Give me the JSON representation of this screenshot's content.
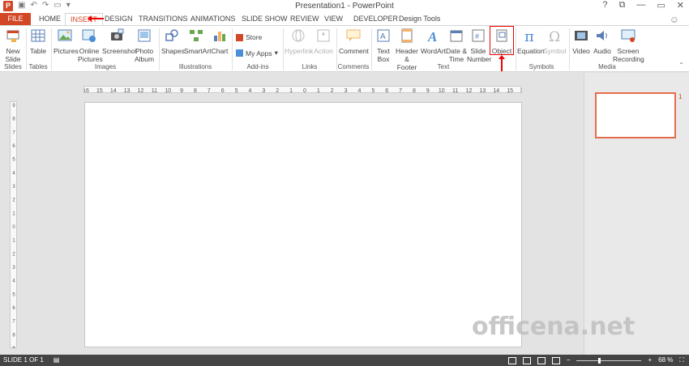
{
  "window": {
    "title": "Presentation1 - PowerPoint",
    "app_icon": "P",
    "controls": [
      "?",
      "⧉",
      "—",
      "▭",
      "✕"
    ]
  },
  "tabs": {
    "file": "FILE",
    "items": [
      "HOME",
      "INSERT",
      "DESIGN",
      "TRANSITIONS",
      "ANIMATIONS",
      "SLIDE SHOW",
      "REVIEW",
      "VIEW",
      "DEVELOPER",
      "Design Tools"
    ],
    "active": "INSERT"
  },
  "ribbon": {
    "slides": {
      "new_slide": "New Slide",
      "label": "Slides"
    },
    "tables": {
      "table": "Table",
      "label": "Tables"
    },
    "images": {
      "pictures": "Pictures",
      "online_pictures": "Online Pictures",
      "screenshot": "Screenshot",
      "photo_album": "Photo Album",
      "label": "Images"
    },
    "illustrations": {
      "shapes": "Shapes",
      "smartart": "SmartArt",
      "chart": "Chart",
      "label": "Illustrations"
    },
    "addins": {
      "store": "Store",
      "my_apps": "My Apps",
      "label": "Add-ins"
    },
    "links": {
      "hyperlink": "Hyperlink",
      "action": "Action",
      "label": "Links"
    },
    "comments": {
      "comment": "Comment",
      "label": "Comments"
    },
    "text": {
      "text_box": "Text Box",
      "header_footer": "Header & Footer",
      "wordart": "WordArt",
      "date_time": "Date & Time",
      "slide_number": "Slide Number",
      "object": "Object",
      "label": "Text"
    },
    "symbols": {
      "equation": "Equation",
      "symbol": "Symbol",
      "label": "Symbols"
    },
    "media": {
      "video": "Video",
      "audio": "Audio",
      "screen_recording": "Screen Recording",
      "label": "Media"
    }
  },
  "ruler": {
    "h_ticks": [
      "16",
      "15",
      "14",
      "13",
      "12",
      "11",
      "10",
      "9",
      "8",
      "7",
      "6",
      "5",
      "4",
      "3",
      "2",
      "1",
      "0",
      "1",
      "2",
      "3",
      "4",
      "5",
      "6",
      "7",
      "8",
      "9",
      "10",
      "11",
      "12",
      "13",
      "14",
      "15",
      "16"
    ],
    "v_ticks": [
      "9",
      "8",
      "7",
      "6",
      "5",
      "4",
      "3",
      "2",
      "1",
      "0",
      "1",
      "2",
      "3",
      "4",
      "5",
      "6",
      "7",
      "8",
      "9"
    ]
  },
  "thumbnail": {
    "number": "1"
  },
  "watermark": "officena.net",
  "status": {
    "slide_info": "SLIDE 1 OF 1",
    "zoom": "68 %",
    "zoom_level": 0.68,
    "colors": {
      "accent": "#d24726",
      "statusbar": "#444444"
    }
  }
}
